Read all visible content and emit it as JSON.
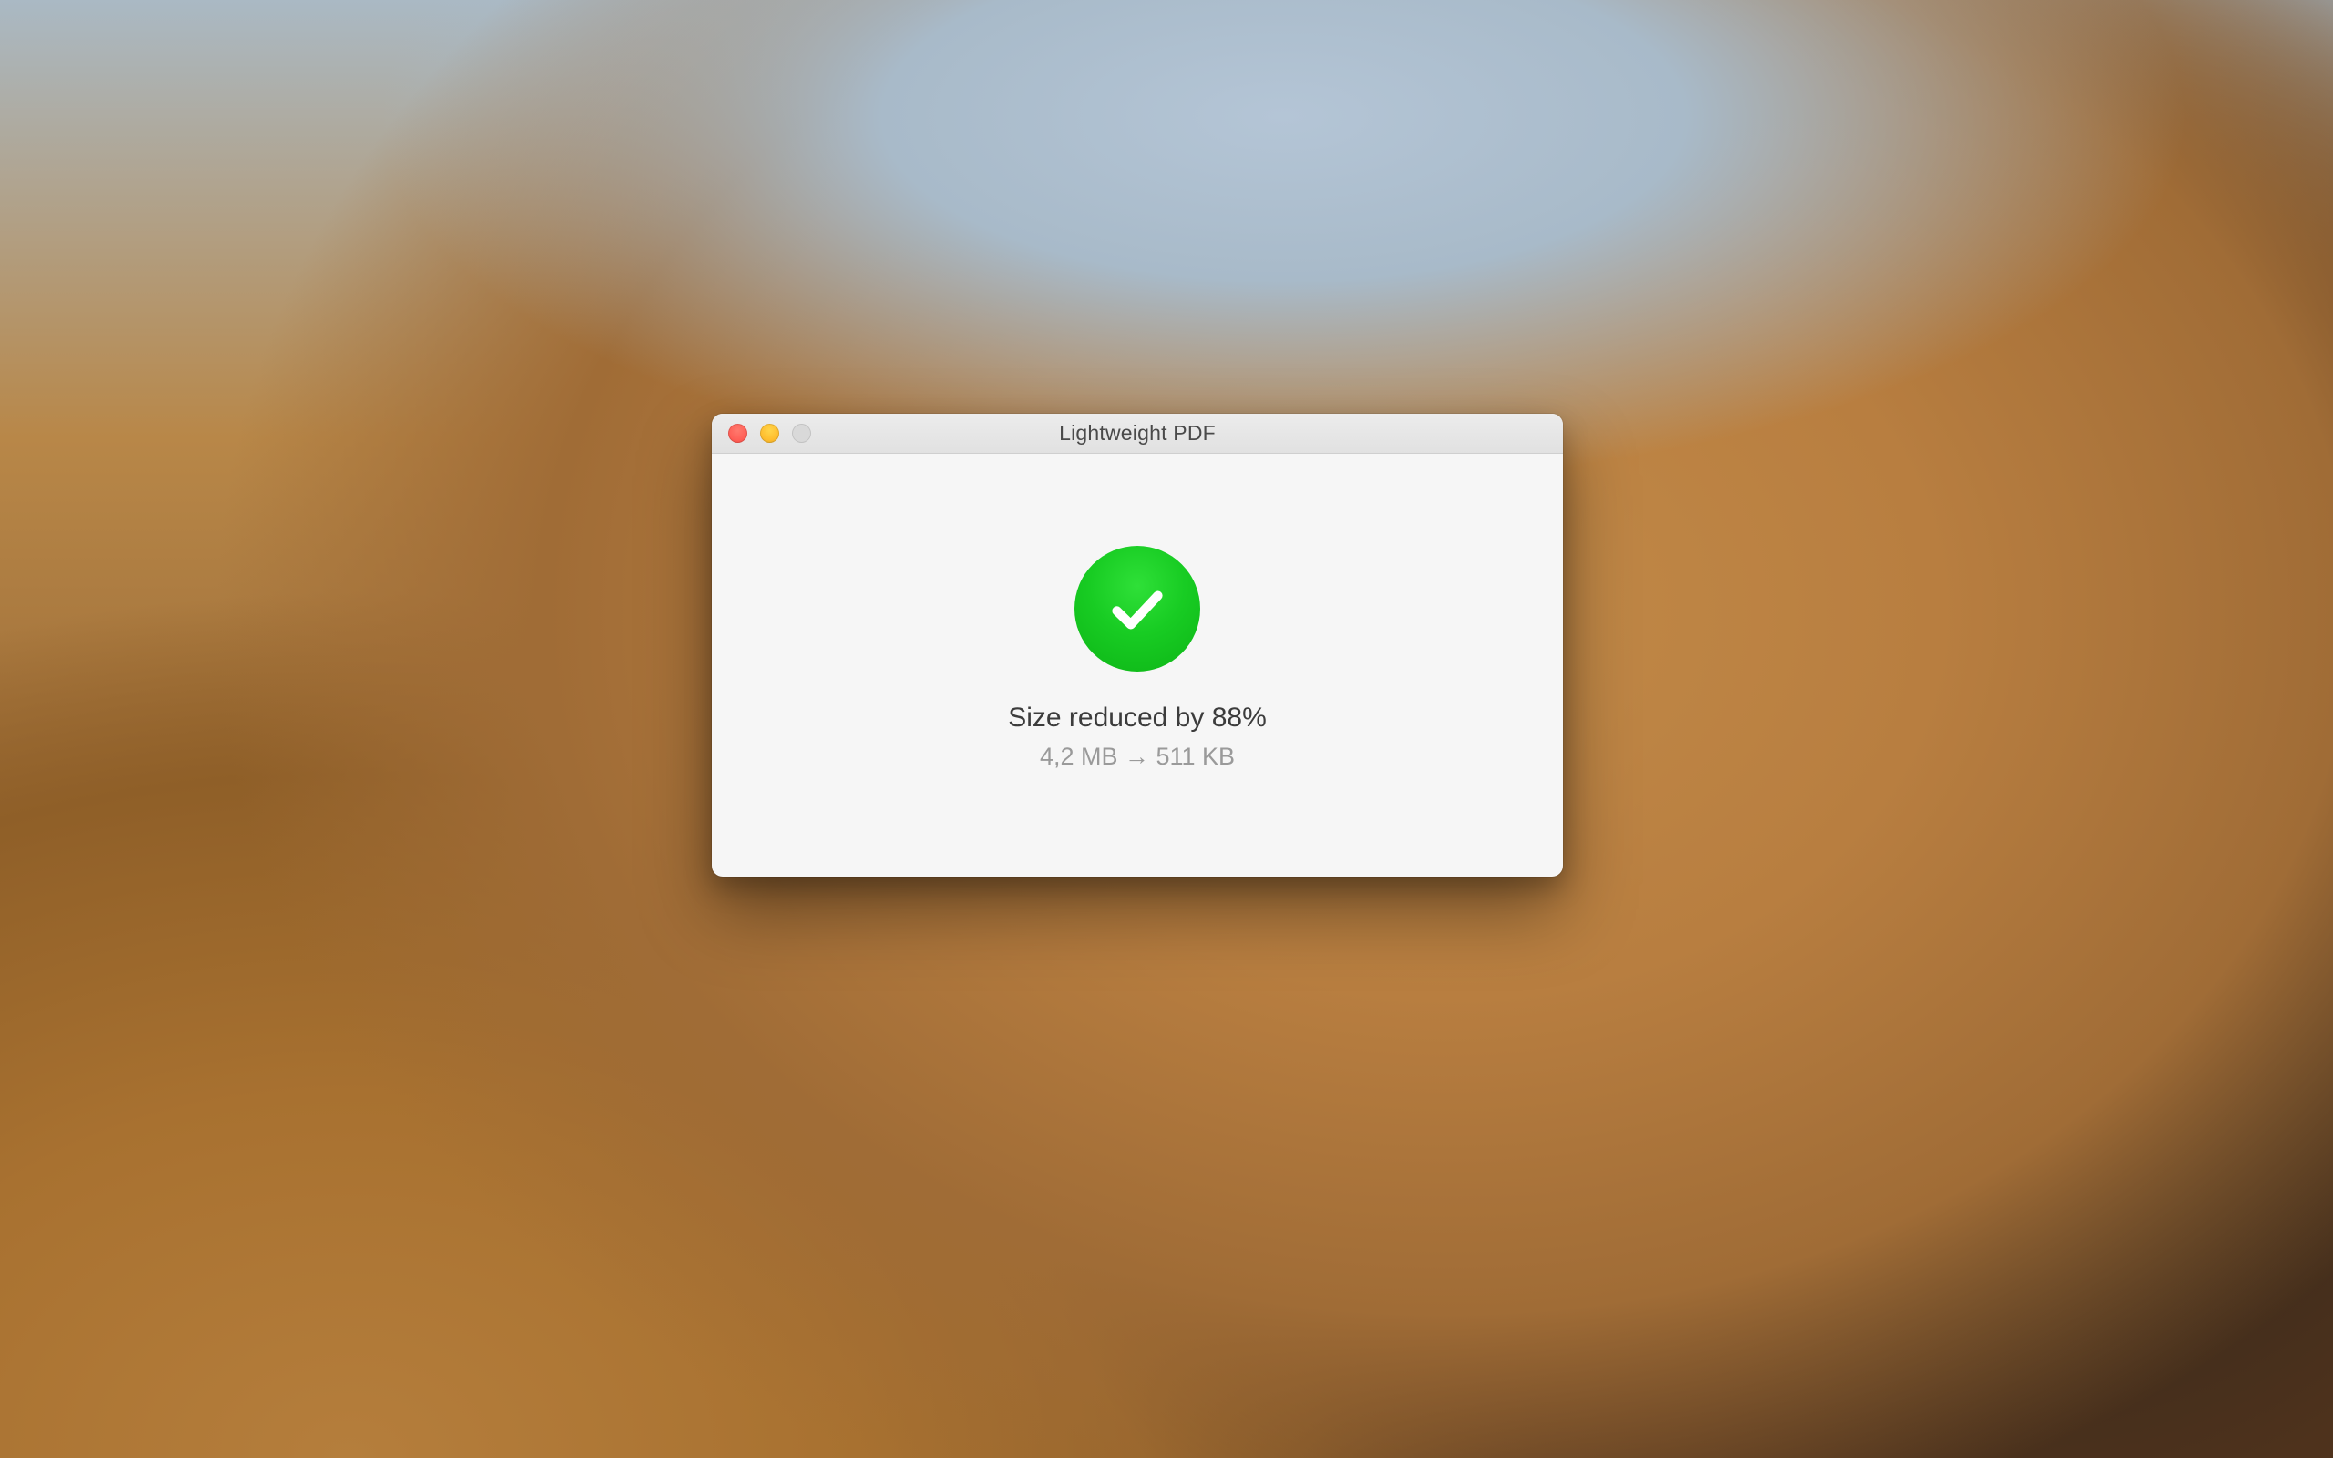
{
  "window": {
    "title": "Lightweight PDF",
    "icon": "checkmark-circle-icon",
    "colors": {
      "accent_green": "#18cc23",
      "titlebar_text": "#4a4a4a",
      "primary_text": "#3c3c3c",
      "secondary_text": "#9a9a9a"
    },
    "result": {
      "primary_message": "Size reduced by 88%",
      "secondary_message": "4,2 MB → 511 KB"
    },
    "traffic_lights": {
      "close": true,
      "minimize": true,
      "maximize_enabled": false
    }
  }
}
